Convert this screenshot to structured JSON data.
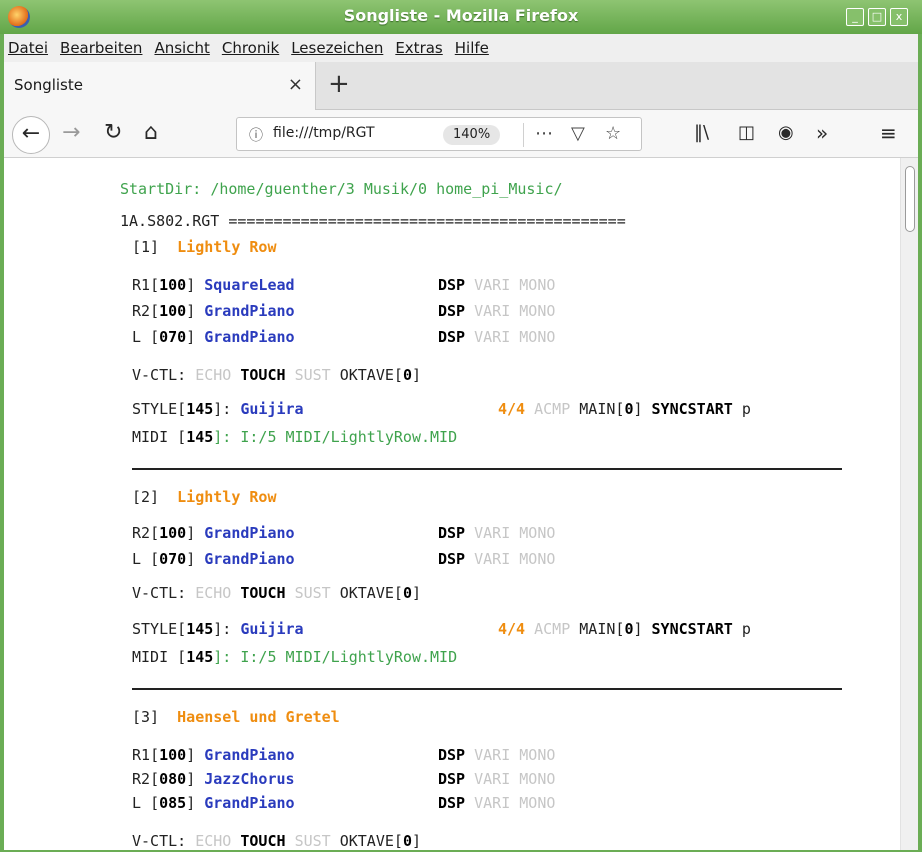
{
  "window": {
    "title": "Songliste - Mozilla Firefox",
    "controls": [
      "_",
      "□",
      "x"
    ]
  },
  "menubar": [
    "Datei",
    "Bearbeiten",
    "Ansicht",
    "Chronik",
    "Lesezeichen",
    "Extras",
    "Hilfe"
  ],
  "tab": {
    "title": "Songliste",
    "close": "×",
    "newtab": "+"
  },
  "nav": {
    "url": "file:///tmp/RGT",
    "zoom": "140%",
    "icons": [
      "back-arrow-icon",
      "forward-arrow-icon",
      "reload-icon",
      "home-icon",
      "info-icon",
      "page-actions-icon",
      "pocket-icon",
      "bookmark-star-icon",
      "library-icon",
      "sidebar-icon",
      "account-icon",
      "overflow-icon",
      "menu-icon"
    ]
  },
  "page": {
    "startdir_label": "StartDir:",
    "startdir_path": "/home/guenther/3 Musik/0 home_pi_Music/",
    "file_header": "1A.S802.RGT ============================================",
    "songs": [
      {
        "num": "[1]",
        "title": "Lightly Row",
        "voices": [
          {
            "part": "R1",
            "vol": "100",
            "name": "SquareLead"
          },
          {
            "part": "R2",
            "vol": "100",
            "name": "GrandPiano"
          },
          {
            "part": "L ",
            "vol": "070",
            "name": "GrandPiano"
          }
        ],
        "style": {
          "tempo": "145",
          "name": "Guijira",
          "meter": "4/4",
          "main": "0"
        },
        "midi": {
          "tempo": "145",
          "path": "I:/5 MIDI/LightlyRow.MID"
        }
      },
      {
        "num": "[2]",
        "title": "Lightly Row",
        "voices": [
          {
            "part": "R2",
            "vol": "100",
            "name": "GrandPiano"
          },
          {
            "part": "L ",
            "vol": "070",
            "name": "GrandPiano"
          }
        ],
        "style": {
          "tempo": "145",
          "name": "Guijira",
          "meter": "4/4",
          "main": "0"
        },
        "midi": {
          "tempo": "145",
          "path": "I:/5 MIDI/LightlyRow.MID"
        }
      },
      {
        "num": "[3]",
        "title": "Haensel und Gretel",
        "voices": [
          {
            "part": "R1",
            "vol": "100",
            "name": "GrandPiano"
          },
          {
            "part": "R2",
            "vol": "080",
            "name": "JazzChorus"
          },
          {
            "part": "L ",
            "vol": "085",
            "name": "GrandPiano"
          }
        ]
      }
    ],
    "labels": {
      "dsp": "DSP",
      "vari": "VARI",
      "mono": "MONO",
      "vctl": "V-CTL:",
      "echo": "ECHO",
      "touch": "TOUCH",
      "sust": "SUST",
      "oktave": "OKTAVE",
      "oktave_val": "0",
      "style": "STYLE",
      "acmp": "ACMP",
      "main": "MAIN",
      "syncstart": "SYNCSTART",
      "trail": "p",
      "midi": "MIDI"
    }
  },
  "colors": {
    "green": "#3fa34d",
    "orange": "#ef8d10",
    "blue": "#2a3bbd",
    "titlebar": "#6bad55"
  }
}
